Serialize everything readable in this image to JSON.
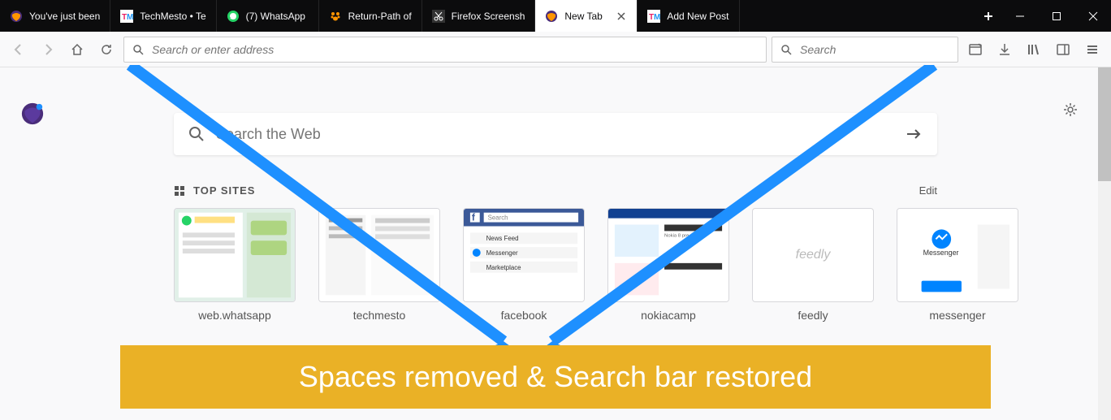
{
  "tabs": [
    {
      "label": "You've just been",
      "favicon": "firefox"
    },
    {
      "label": "TechMesto • Te",
      "favicon": "tm"
    },
    {
      "label": "(7) WhatsApp",
      "favicon": "whatsapp"
    },
    {
      "label": "Return-Path of",
      "favicon": "paw"
    },
    {
      "label": "Firefox Screensh",
      "favicon": "scissors"
    },
    {
      "label": "New Tab",
      "favicon": "firefox",
      "active": true,
      "closable": true
    },
    {
      "label": "Add New Post",
      "favicon": "tm"
    }
  ],
  "nav": {
    "url_placeholder": "Search or enter address",
    "search_placeholder": "Search"
  },
  "content": {
    "web_search_placeholder": "Search the Web",
    "top_sites_header": "TOP SITES",
    "edit_label": "Edit",
    "sites": [
      {
        "name": "web.whatsapp"
      },
      {
        "name": "techmesto"
      },
      {
        "name": "facebook"
      },
      {
        "name": "nokiacamp"
      },
      {
        "name": "feedly"
      },
      {
        "name": "messenger"
      }
    ]
  },
  "annotation": {
    "banner_text": "Spaces removed & Search bar restored"
  },
  "colors": {
    "accent_blue": "#1e90ff",
    "banner_bg": "#eab126"
  }
}
